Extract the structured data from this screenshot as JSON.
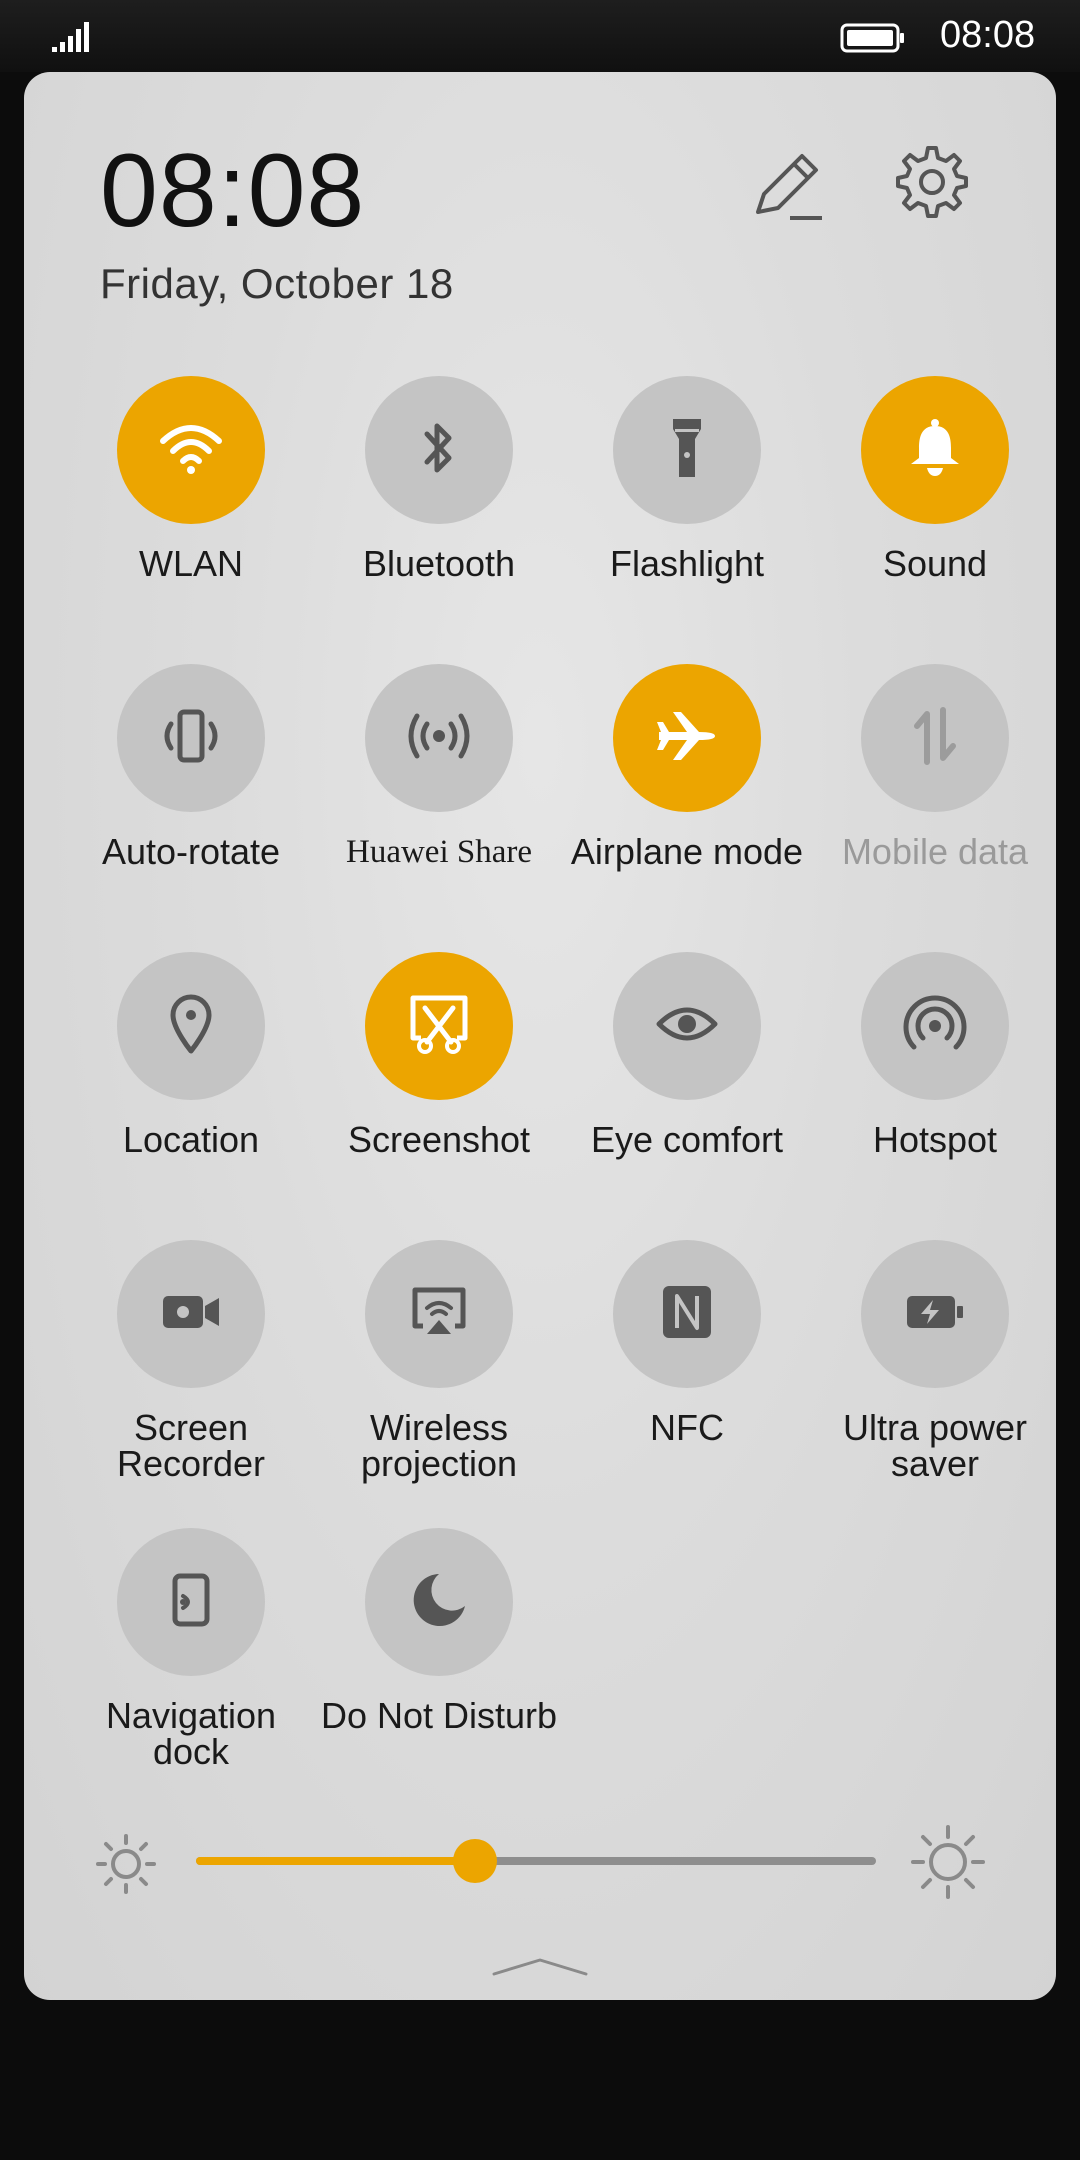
{
  "status_bar": {
    "time": "08:08",
    "signal_icon": "signal-bars-icon",
    "battery_icon": "battery-full-icon"
  },
  "header": {
    "time": "08:08",
    "date": "Friday,  October  18",
    "edit_icon": "pencil-icon",
    "settings_icon": "gear-icon"
  },
  "colors": {
    "accent": "#eca500",
    "tile_off": "#c4c4c4",
    "panel": "#dcdcdc"
  },
  "tiles": [
    {
      "label": "WLAN",
      "icon": "wifi-icon",
      "state": "on"
    },
    {
      "label": "Bluetooth",
      "icon": "bluetooth-icon",
      "state": "off"
    },
    {
      "label": "Flashlight",
      "icon": "flashlight-icon",
      "state": "off"
    },
    {
      "label": "Sound",
      "icon": "bell-icon",
      "state": "on"
    },
    {
      "label": "Auto-rotate",
      "icon": "auto-rotate-icon",
      "state": "off"
    },
    {
      "label": "Huawei Share",
      "icon": "share-signal-icon",
      "state": "off"
    },
    {
      "label": "Airplane mode",
      "icon": "airplane-icon",
      "state": "on"
    },
    {
      "label": "Mobile data",
      "icon": "mobile-data-icon",
      "state": "disabled"
    },
    {
      "label": "Location",
      "icon": "location-pin-icon",
      "state": "off"
    },
    {
      "label": "Screenshot",
      "icon": "screenshot-scissors-icon",
      "state": "on"
    },
    {
      "label": "Eye comfort",
      "icon": "eye-icon",
      "state": "off"
    },
    {
      "label": "Hotspot",
      "icon": "hotspot-icon",
      "state": "off"
    },
    {
      "label": "Screen Recorder",
      "icon": "video-camera-icon",
      "state": "off"
    },
    {
      "label": "Wireless projection",
      "icon": "wireless-projection-icon",
      "state": "off"
    },
    {
      "label": "NFC",
      "icon": "nfc-icon",
      "state": "off"
    },
    {
      "label": "Ultra power saver",
      "icon": "battery-bolt-icon",
      "state": "off"
    },
    {
      "label": "Navigation dock",
      "icon": "navigation-dock-icon",
      "state": "off"
    },
    {
      "label": "Do Not Disturb",
      "icon": "moon-icon",
      "state": "off"
    }
  ],
  "brightness": {
    "level_fraction": 0.41,
    "low_icon": "sun-small-icon",
    "high_icon": "sun-large-icon"
  },
  "collapse_icon": "chevron-up-icon"
}
